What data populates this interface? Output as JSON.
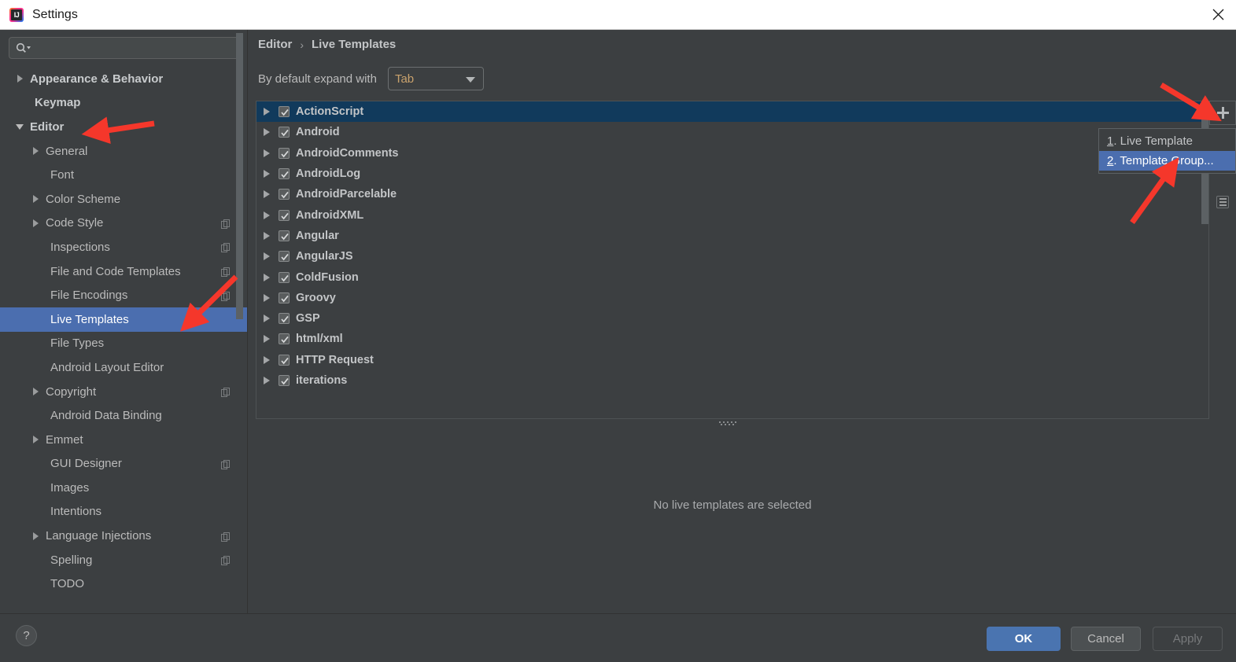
{
  "window": {
    "title": "Settings",
    "logo_icon": "intellij-idea-logo",
    "close_icon": "close-icon"
  },
  "sidebar": {
    "search": {
      "placeholder": "",
      "value": "",
      "icon": "search-icon"
    },
    "items": [
      {
        "label": "Appearance & Behavior",
        "level": 0,
        "arrow": "right",
        "selected": false,
        "badge": false
      },
      {
        "label": "Keymap",
        "level": 0,
        "arrow": "none",
        "selected": false,
        "badge": false
      },
      {
        "label": "Editor",
        "level": 0,
        "arrow": "down",
        "selected": false,
        "badge": false
      },
      {
        "label": "General",
        "level": 1,
        "arrow": "right",
        "selected": false,
        "badge": false
      },
      {
        "label": "Font",
        "level": 1,
        "arrow": "none",
        "selected": false,
        "badge": false
      },
      {
        "label": "Color Scheme",
        "level": 1,
        "arrow": "right",
        "selected": false,
        "badge": false
      },
      {
        "label": "Code Style",
        "level": 1,
        "arrow": "right",
        "selected": false,
        "badge": true
      },
      {
        "label": "Inspections",
        "level": 1,
        "arrow": "none",
        "selected": false,
        "badge": true
      },
      {
        "label": "File and Code Templates",
        "level": 1,
        "arrow": "none",
        "selected": false,
        "badge": true
      },
      {
        "label": "File Encodings",
        "level": 1,
        "arrow": "none",
        "selected": false,
        "badge": true
      },
      {
        "label": "Live Templates",
        "level": 1,
        "arrow": "none",
        "selected": true,
        "badge": false
      },
      {
        "label": "File Types",
        "level": 1,
        "arrow": "none",
        "selected": false,
        "badge": false
      },
      {
        "label": "Android Layout Editor",
        "level": 1,
        "arrow": "none",
        "selected": false,
        "badge": false
      },
      {
        "label": "Copyright",
        "level": 1,
        "arrow": "right",
        "selected": false,
        "badge": true
      },
      {
        "label": "Android Data Binding",
        "level": 1,
        "arrow": "none",
        "selected": false,
        "badge": false
      },
      {
        "label": "Emmet",
        "level": 1,
        "arrow": "right",
        "selected": false,
        "badge": false
      },
      {
        "label": "GUI Designer",
        "level": 1,
        "arrow": "none",
        "selected": false,
        "badge": true
      },
      {
        "label": "Images",
        "level": 1,
        "arrow": "none",
        "selected": false,
        "badge": false
      },
      {
        "label": "Intentions",
        "level": 1,
        "arrow": "none",
        "selected": false,
        "badge": false
      },
      {
        "label": "Language Injections",
        "level": 1,
        "arrow": "right",
        "selected": false,
        "badge": true
      },
      {
        "label": "Spelling",
        "level": 1,
        "arrow": "none",
        "selected": false,
        "badge": true
      },
      {
        "label": "TODO",
        "level": 1,
        "arrow": "none",
        "selected": false,
        "badge": false
      }
    ]
  },
  "main": {
    "breadcrumb": {
      "parent": "Editor",
      "separator": "›",
      "current": "Live Templates"
    },
    "expand_with": {
      "label": "By default expand with",
      "value": "Tab"
    },
    "empty_message": "No live templates are selected",
    "toolbar": {
      "add_icon": "plus-icon",
      "menu_icon": "list-menu-icon"
    },
    "template_groups": [
      {
        "label": "ActionScript",
        "checked": true,
        "selected": true
      },
      {
        "label": "Android",
        "checked": true,
        "selected": false
      },
      {
        "label": "AndroidComments",
        "checked": true,
        "selected": false
      },
      {
        "label": "AndroidLog",
        "checked": true,
        "selected": false
      },
      {
        "label": "AndroidParcelable",
        "checked": true,
        "selected": false
      },
      {
        "label": "AndroidXML",
        "checked": true,
        "selected": false
      },
      {
        "label": "Angular",
        "checked": true,
        "selected": false
      },
      {
        "label": "AngularJS",
        "checked": true,
        "selected": false
      },
      {
        "label": "ColdFusion",
        "checked": true,
        "selected": false
      },
      {
        "label": "Groovy",
        "checked": true,
        "selected": false
      },
      {
        "label": "GSP",
        "checked": true,
        "selected": false
      },
      {
        "label": "html/xml",
        "checked": true,
        "selected": false
      },
      {
        "label": "HTTP Request",
        "checked": true,
        "selected": false
      },
      {
        "label": "iterations",
        "checked": true,
        "selected": false
      }
    ]
  },
  "popup_menu": {
    "items": [
      {
        "mnemonic": "1",
        "label": ". Live Template",
        "highlighted": false
      },
      {
        "mnemonic": "2",
        "label": ". Template Group...",
        "highlighted": true
      }
    ]
  },
  "footer": {
    "help_label": "?",
    "ok_label": "OK",
    "cancel_label": "Cancel",
    "apply_label": "Apply"
  },
  "colors": {
    "background": "#3c3f41",
    "selection_blue": "#4b6eaf",
    "list_selection": "#113a5c",
    "primary_button": "#4a74b0",
    "annotation_red": "#f5372b",
    "combo_value": "#c9a26d"
  }
}
